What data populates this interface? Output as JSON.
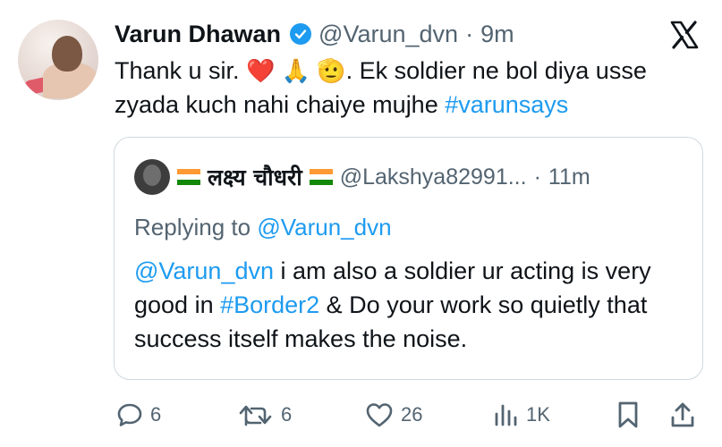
{
  "tweet": {
    "author_name": "Varun Dhawan",
    "author_handle": "@Varun_dvn",
    "separator": "·",
    "time": "9m",
    "text_before_emoji": "Thank u sir. ",
    "emojis": "❤️ 🙏 🫡",
    "text_after_emoji": ". Ek soldier ne bol diya usse zyada kuch nahi chaiye mujhe ",
    "hashtag": "#varunsays"
  },
  "quoted_tweet": {
    "author_name": "लक्ष्य चौधरी",
    "author_handle": "@Lakshya82991...",
    "separator": "·",
    "time": "11m",
    "replying_prefix": "Replying to ",
    "replying_handle": "@Varun_dvn",
    "mention": "@Varun_dvn",
    "text_1": " i am also a soldier ur acting is very good in ",
    "hashtag": "#Border2",
    "text_2": " & Do your work so quietly that success itself makes the noise."
  },
  "actions": {
    "replies": "6",
    "reposts": "6",
    "likes": "26",
    "views": "1K"
  },
  "colors": {
    "accent": "#1d9bf0",
    "secondary_text": "#536471",
    "text": "#0f1419",
    "border": "#cfd9de"
  },
  "icons": [
    "verified-badge-icon",
    "x-logo-icon",
    "reply-icon",
    "repost-icon",
    "like-icon",
    "views-icon",
    "bookmark-icon",
    "share-icon"
  ]
}
